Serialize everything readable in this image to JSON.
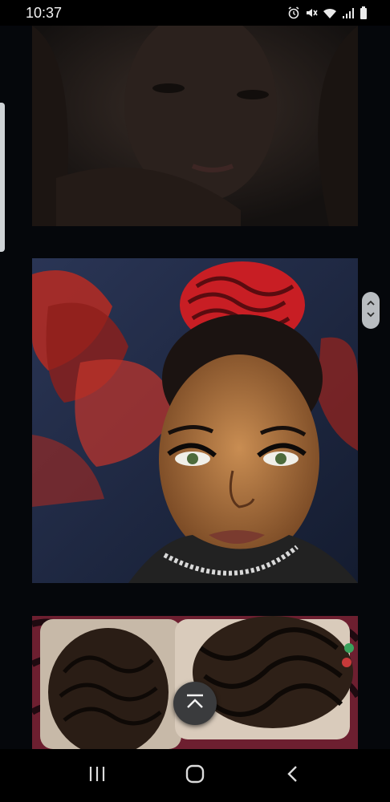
{
  "status_bar": {
    "time": "10:37",
    "icons": [
      "alarm-icon",
      "mute-icon",
      "wifi-icon",
      "signal-icon",
      "battery-icon"
    ]
  },
  "feed": {
    "items": [
      {
        "name": "photo-selfie-dim",
        "colors": [
          "#2a2523",
          "#15120f",
          "#3a2b22"
        ]
      },
      {
        "name": "photo-selfie-red-braids",
        "colors": [
          "#d31f26",
          "#1e2b45",
          "#c98a4f"
        ]
      },
      {
        "name": "photo-braid-collage",
        "colors": [
          "#7a2235",
          "#c9b7a4",
          "#1a1410"
        ]
      }
    ]
  },
  "controls": {
    "scroll_top_icon": "chevron-up-bar-icon",
    "fast_scroll_icon": "up-down-chevron-icon"
  },
  "nav_bar": {
    "items": [
      "recent-apps-icon",
      "home-icon",
      "back-icon"
    ]
  }
}
